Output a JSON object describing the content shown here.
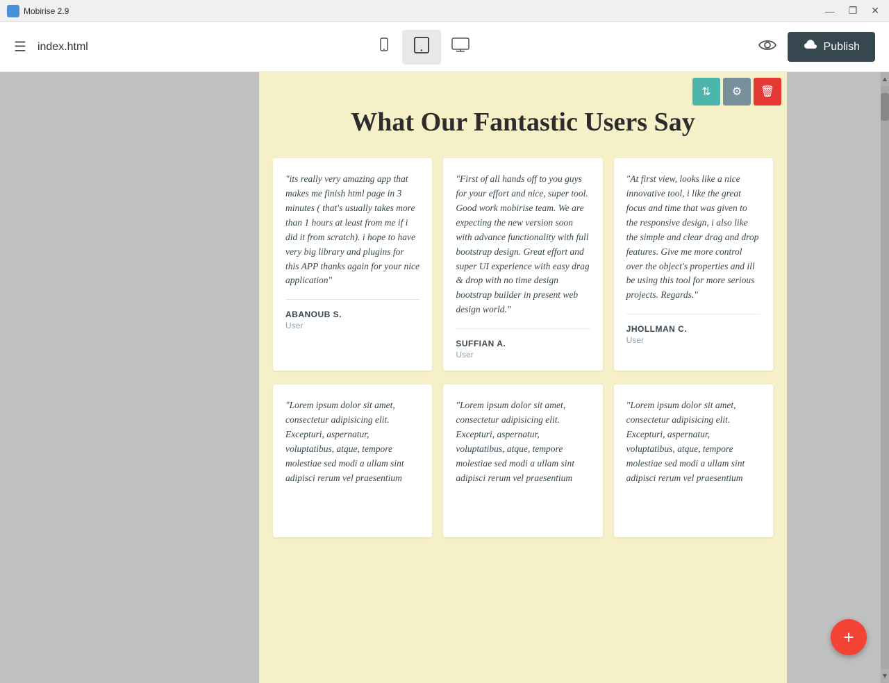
{
  "titlebar": {
    "title": "Mobirise 2.9",
    "controls": {
      "minimize": "—",
      "restore": "❐",
      "close": "✕"
    }
  },
  "toolbar": {
    "menu_label": "☰",
    "filename": "index.html",
    "devices": [
      {
        "label": "📱",
        "id": "mobile",
        "active": false
      },
      {
        "label": "⬛",
        "id": "tablet",
        "active": true
      },
      {
        "label": "🖥",
        "id": "desktop",
        "active": false
      }
    ],
    "preview_label": "👁",
    "publish_label": "Publish",
    "publish_cloud": "☁"
  },
  "block_toolbar": {
    "reorder_icon": "⇅",
    "settings_icon": "⚙",
    "delete_icon": "🗑"
  },
  "section": {
    "heading": "What Our Fantastic Users Say"
  },
  "testimonials": [
    {
      "quote": "\"its really very amazing app that makes me finish html page in 3 minutes ( that's usually takes more than 1 hours at least from me if i did it from scratch). i hope to have very big library and plugins for this APP thanks again for your nice application\"",
      "author_name": "ABANOUB S.",
      "author_role": "User"
    },
    {
      "quote": "\"First of all hands off to you guys for your effort and nice, super tool. Good work mobirise team. We are expecting the new version soon with advance functionality with full bootstrap design. Great effort and super UI experience with easy drag & drop with no time design bootstrap builder in present web design world.\"",
      "author_name": "SUFFIAN A.",
      "author_role": "User"
    },
    {
      "quote": "\"At first view, looks like a nice innovative tool, i like the great focus and time that was given to the responsive design, i also like the simple and clear drag and drop features. Give me more control over the object's properties and ill be using this tool for more serious projects. Regards.\"",
      "author_name": "JHOLLMAN C.",
      "author_role": "User"
    }
  ],
  "lorem_testimonials": [
    {
      "quote": "\"Lorem ipsum dolor sit amet, consectetur adipisicing elit. Excepturi, aspernatur, voluptatibus, atque, tempore molestiae sed modi a ullam sint adipisci rerum vel praesentium",
      "author_name": "",
      "author_role": ""
    },
    {
      "quote": "\"Lorem ipsum dolor sit amet, consectetur adipisicing elit. Excepturi, aspernatur, voluptatibus, atque, tempore molestiae sed modi a ullam sint adipisci rerum vel praesentium",
      "author_name": "",
      "author_role": ""
    },
    {
      "quote": "\"Lorem ipsum dolor sit amet, consectetur adipisicing elit. Excepturi, aspernatur, voluptatibus, atque, tempore molestiae sed modi a ullam sint adipisci rerum vel praesentium",
      "author_name": "",
      "author_role": ""
    }
  ],
  "fab": {
    "label": "+"
  },
  "colors": {
    "background": "#f5f0c8",
    "btn_teal": "#4db6ac",
    "btn_gray": "#78909c",
    "btn_red": "#e53935",
    "fab_red": "#f44336",
    "publish_bg": "#37474f",
    "quote_color": "#37474f",
    "author_color": "#37474f",
    "role_color": "#90a4ae"
  }
}
